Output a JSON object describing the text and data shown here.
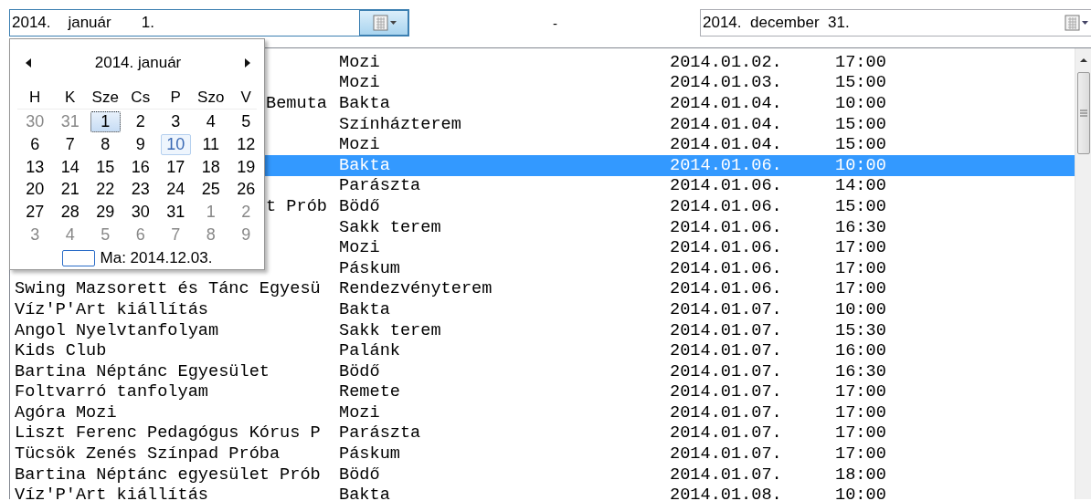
{
  "date_from": {
    "value": "2014.    január       1."
  },
  "separator": "-",
  "date_to": {
    "value": "2014.  december  31."
  },
  "calendar": {
    "title": "2014. január",
    "weekdays": [
      "H",
      "K",
      "Sze",
      "Cs",
      "P",
      "Szo",
      "V"
    ],
    "days": [
      {
        "label": "30",
        "other_month": true,
        "selected": false,
        "highlighted": false
      },
      {
        "label": "31",
        "other_month": true,
        "selected": false,
        "highlighted": false
      },
      {
        "label": "1",
        "other_month": false,
        "selected": true,
        "highlighted": false
      },
      {
        "label": "2",
        "other_month": false,
        "selected": false,
        "highlighted": false
      },
      {
        "label": "3",
        "other_month": false,
        "selected": false,
        "highlighted": false
      },
      {
        "label": "4",
        "other_month": false,
        "selected": false,
        "highlighted": false
      },
      {
        "label": "5",
        "other_month": false,
        "selected": false,
        "highlighted": false
      },
      {
        "label": "6",
        "other_month": false,
        "selected": false,
        "highlighted": false
      },
      {
        "label": "7",
        "other_month": false,
        "selected": false,
        "highlighted": false
      },
      {
        "label": "8",
        "other_month": false,
        "selected": false,
        "highlighted": false
      },
      {
        "label": "9",
        "other_month": false,
        "selected": false,
        "highlighted": false
      },
      {
        "label": "10",
        "other_month": false,
        "selected": false,
        "highlighted": true
      },
      {
        "label": "11",
        "other_month": false,
        "selected": false,
        "highlighted": false
      },
      {
        "label": "12",
        "other_month": false,
        "selected": false,
        "highlighted": false
      },
      {
        "label": "13",
        "other_month": false,
        "selected": false,
        "highlighted": false
      },
      {
        "label": "14",
        "other_month": false,
        "selected": false,
        "highlighted": false
      },
      {
        "label": "15",
        "other_month": false,
        "selected": false,
        "highlighted": false
      },
      {
        "label": "16",
        "other_month": false,
        "selected": false,
        "highlighted": false
      },
      {
        "label": "17",
        "other_month": false,
        "selected": false,
        "highlighted": false
      },
      {
        "label": "18",
        "other_month": false,
        "selected": false,
        "highlighted": false
      },
      {
        "label": "19",
        "other_month": false,
        "selected": false,
        "highlighted": false
      },
      {
        "label": "20",
        "other_month": false,
        "selected": false,
        "highlighted": false
      },
      {
        "label": "21",
        "other_month": false,
        "selected": false,
        "highlighted": false
      },
      {
        "label": "22",
        "other_month": false,
        "selected": false,
        "highlighted": false
      },
      {
        "label": "23",
        "other_month": false,
        "selected": false,
        "highlighted": false
      },
      {
        "label": "24",
        "other_month": false,
        "selected": false,
        "highlighted": false
      },
      {
        "label": "25",
        "other_month": false,
        "selected": false,
        "highlighted": false
      },
      {
        "label": "26",
        "other_month": false,
        "selected": false,
        "highlighted": false
      },
      {
        "label": "27",
        "other_month": false,
        "selected": false,
        "highlighted": false
      },
      {
        "label": "28",
        "other_month": false,
        "selected": false,
        "highlighted": false
      },
      {
        "label": "29",
        "other_month": false,
        "selected": false,
        "highlighted": false
      },
      {
        "label": "30",
        "other_month": false,
        "selected": false,
        "highlighted": false
      },
      {
        "label": "31",
        "other_month": false,
        "selected": false,
        "highlighted": false
      },
      {
        "label": "1",
        "other_month": true,
        "selected": false,
        "highlighted": false
      },
      {
        "label": "2",
        "other_month": true,
        "selected": false,
        "highlighted": false
      },
      {
        "label": "3",
        "other_month": true,
        "selected": false,
        "highlighted": false
      },
      {
        "label": "4",
        "other_month": true,
        "selected": false,
        "highlighted": false
      },
      {
        "label": "5",
        "other_month": true,
        "selected": false,
        "highlighted": false
      },
      {
        "label": "6",
        "other_month": true,
        "selected": false,
        "highlighted": false
      },
      {
        "label": "7",
        "other_month": true,
        "selected": false,
        "highlighted": false
      },
      {
        "label": "8",
        "other_month": true,
        "selected": false,
        "highlighted": false
      },
      {
        "label": "9",
        "other_month": true,
        "selected": false,
        "highlighted": false
      }
    ],
    "today": "Ma: 2014.12.03."
  },
  "rows": [
    {
      "location": "Mozi",
      "date": "2014.01.02.",
      "time": "17:00",
      "selected": false
    },
    {
      "location": "Mozi",
      "date": "2014.01.03.",
      "time": "15:00",
      "selected": false
    },
    {
      "name": "Bemuta",
      "name_covered": true,
      "location": "Bakta",
      "date": "2014.01.04.",
      "time": "10:00",
      "selected": false
    },
    {
      "location": "Színházterem",
      "date": "2014.01.04.",
      "time": "15:00",
      "selected": false
    },
    {
      "location": "Mozi",
      "date": "2014.01.04.",
      "time": "15:00",
      "selected": false
    },
    {
      "location": "Bakta",
      "date": "2014.01.06.",
      "time": "10:00",
      "selected": true
    },
    {
      "location": "Parászta",
      "date": "2014.01.06.",
      "time": "14:00",
      "selected": false
    },
    {
      "name": "t Prób",
      "name_covered": true,
      "location": "Bödő",
      "date": "2014.01.06.",
      "time": "15:00",
      "selected": false
    },
    {
      "location": "Sakk terem",
      "date": "2014.01.06.",
      "time": "16:30",
      "selected": false
    },
    {
      "location": "Mozi",
      "date": "2014.01.06.",
      "time": "17:00",
      "selected": false
    },
    {
      "location": "Páskum",
      "date": "2014.01.06.",
      "time": "17:00",
      "selected": false
    },
    {
      "name": "Swing Mazsorett és Tánc Egyesü",
      "location": "Rendezvényterem",
      "date": "2014.01.06.",
      "time": "17:00",
      "selected": false
    },
    {
      "name": "Víz'P'Art kiállítás",
      "location": "Bakta",
      "date": "2014.01.07.",
      "time": "10:00",
      "selected": false
    },
    {
      "name": "Angol Nyelvtanfolyam",
      "location": "Sakk terem",
      "date": "2014.01.07.",
      "time": "15:30",
      "selected": false
    },
    {
      "name": "Kids Club",
      "location": "Palánk",
      "date": "2014.01.07.",
      "time": "16:00",
      "selected": false
    },
    {
      "name": "Bartina Néptánc Egyesület",
      "location": "Bödő",
      "date": "2014.01.07.",
      "time": "16:30",
      "selected": false
    },
    {
      "name": "Foltvarró tanfolyam",
      "location": "Remete",
      "date": "2014.01.07.",
      "time": "17:00",
      "selected": false
    },
    {
      "name": "Agóra Mozi",
      "location": "Mozi",
      "date": "2014.01.07.",
      "time": "17:00",
      "selected": false
    },
    {
      "name": "Liszt Ferenc Pedagógus Kórus P",
      "location": "Parászta",
      "date": "2014.01.07.",
      "time": "17:00",
      "selected": false
    },
    {
      "name": "Tücsök Zenés Színpad Próba",
      "location": "Páskum",
      "date": "2014.01.07.",
      "time": "17:00",
      "selected": false
    },
    {
      "name": "Bartina Néptánc egyesület Prób",
      "location": "Bödő",
      "date": "2014.01.07.",
      "time": "18:00",
      "selected": false
    },
    {
      "name": "Víz'P'Art kiállítás",
      "location": "Bakta",
      "date": "2014.01.08.",
      "time": "10:00",
      "selected": false
    }
  ]
}
